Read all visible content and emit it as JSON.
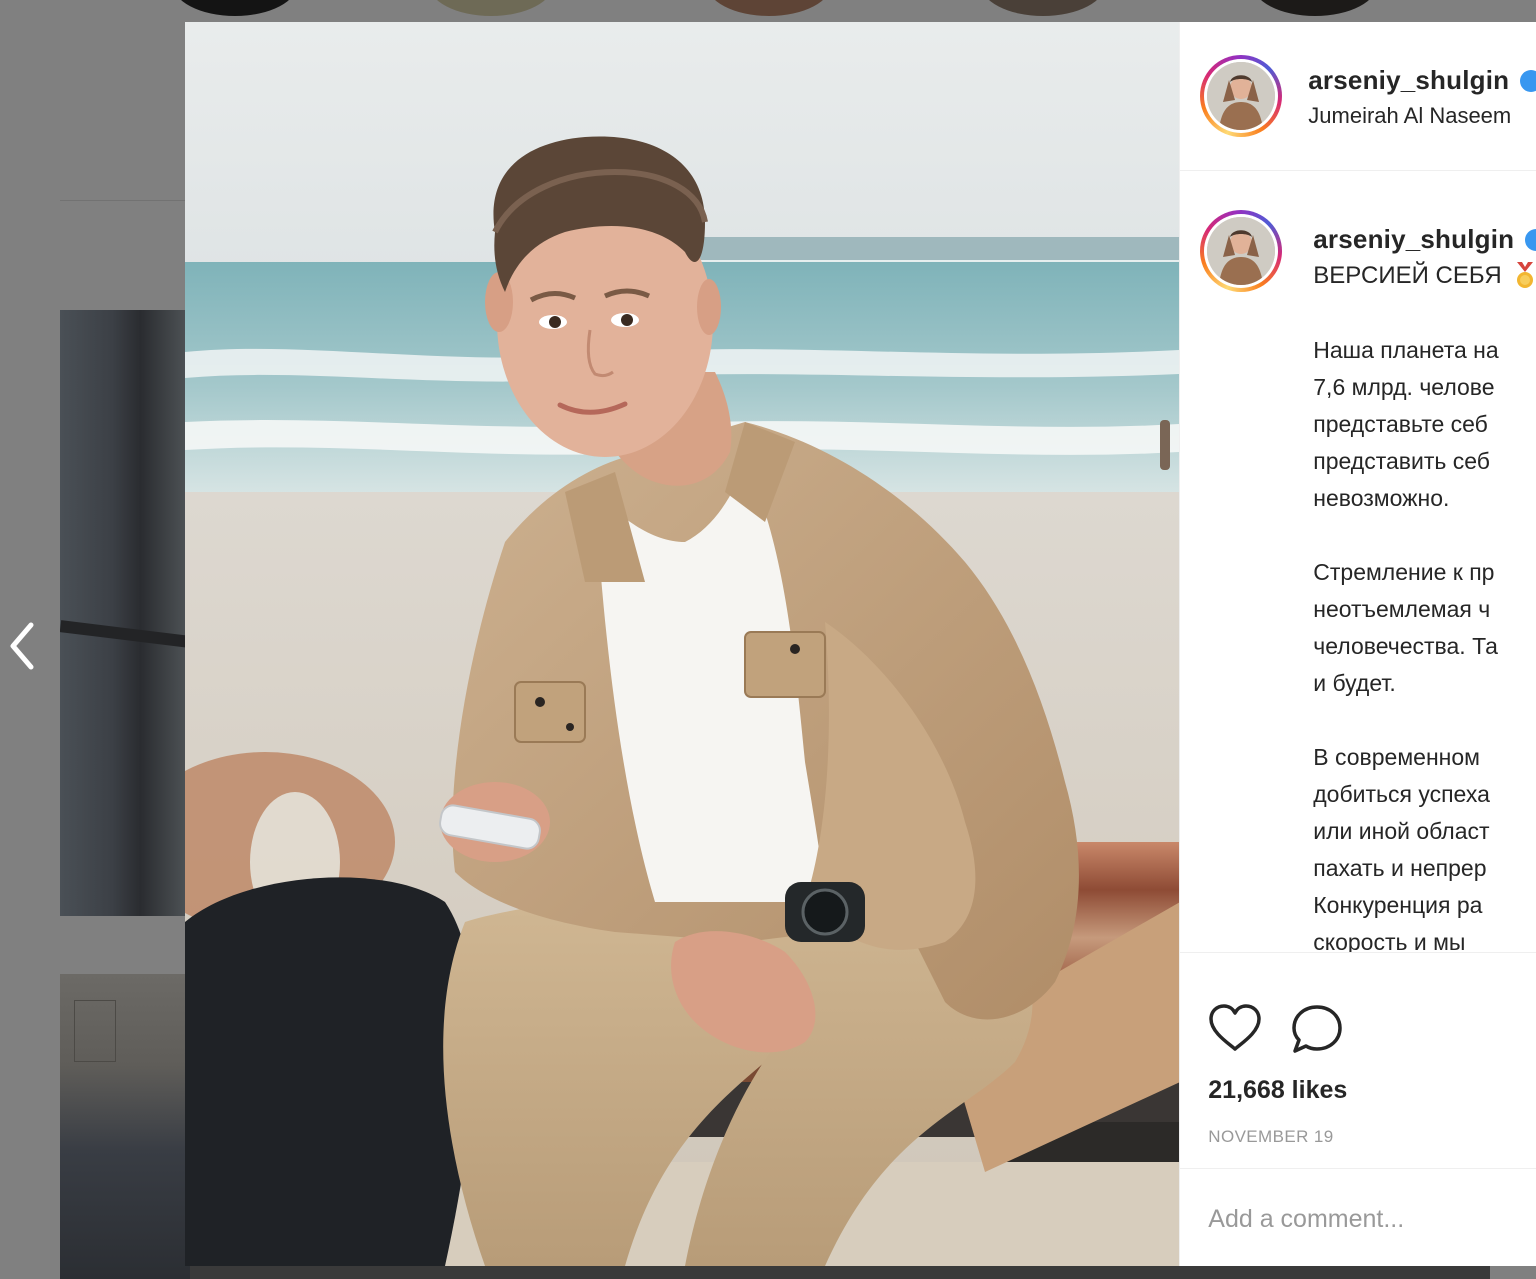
{
  "post": {
    "username": "arseniy_shulgin",
    "location": "Jumeirah Al Naseem",
    "caption_first_line": "ВЕРСИЕЙ СЕБЯ",
    "caption_lines": [
      "Наша планета на",
      "7,6 млрд. челове",
      "представьте себ",
      "представить себ",
      "невозможно.",
      "",
      "Стремление к пр",
      "неотъемлемая ч",
      "человечества. Та",
      "и будет.",
      "",
      "В современном",
      "добиться успеха",
      "или иной област",
      "пахать и непрер",
      "Конкуренция ра",
      "скорость и мы"
    ],
    "likes": "21,668 likes",
    "date": "NOVEMBER 19",
    "comment_placeholder": "Add a comment..."
  },
  "icons": {
    "prev": "chevron-left-icon",
    "like": "heart-icon",
    "comment": "comment-icon",
    "verified": "verified-badge-icon",
    "medal": "medal-emoji"
  },
  "colors": {
    "backdrop": "#808080",
    "text": "#262626",
    "muted": "#999999",
    "verified": "#3897f0",
    "divider": "#efefef"
  }
}
